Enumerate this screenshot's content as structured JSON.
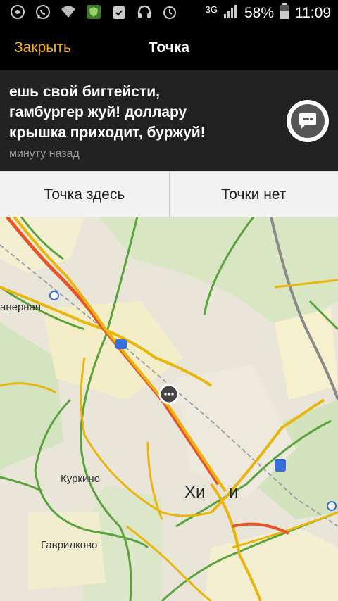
{
  "status_bar": {
    "network": "3G",
    "battery_percent": "58%",
    "time": "11:09",
    "icons": [
      "accessibility-icon",
      "whatsapp-icon",
      "wifi-icon",
      "shield-app-icon",
      "clipboard-icon",
      "headset-icon",
      "alarm-icon",
      "signal-icon",
      "battery-icon"
    ]
  },
  "header": {
    "close_label": "Закрыть",
    "title": "Точка"
  },
  "message": {
    "text": "ешь свой бигтейсти,\nгамбургер жуй! доллару\nкрышка приходит, буржуй!",
    "time": "минуту назад"
  },
  "actions": {
    "here_label": "Точка здесь",
    "not_here_label": "Точки нет"
  },
  "map": {
    "labels": {
      "top_left": "анерная",
      "kurkino": "Куркино",
      "gavrilkovo": "Гаврилково",
      "khimki_a": "Хи",
      "khimki_b": "и"
    }
  },
  "colors": {
    "accent": "#f5b400",
    "traffic_red": "#e8532a",
    "traffic_yellow": "#e8b60f",
    "traffic_green": "#5aa33c"
  }
}
